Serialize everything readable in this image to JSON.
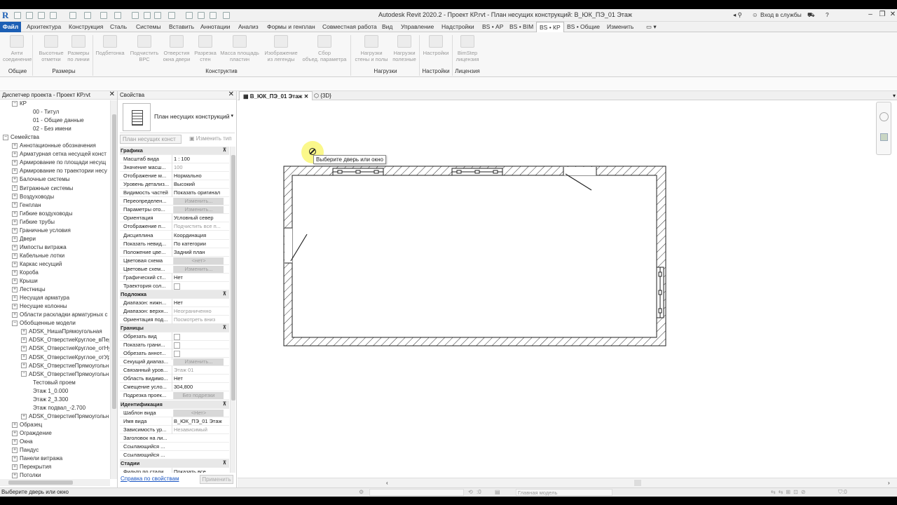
{
  "window": {
    "title": "Autodesk Revit 2020.2 - Проект КР.rvt - План несущих конструкций: В_ЮК_ПЭ_01 Этаж",
    "login": "Вход в службы",
    "help": "?"
  },
  "menu": {
    "file": "Файл",
    "tabs": [
      "Архитектура",
      "Конструкция",
      "Сталь",
      "Системы",
      "Вставить",
      "Аннотации",
      "Анализ",
      "Формы и генплан",
      "Совместная работа",
      "Вид",
      "Управление",
      "Надстройки",
      "BS • АР",
      "BS • BIM",
      "BS • КР",
      "BS • Общие",
      "Изменить"
    ],
    "active": "BS • КР"
  },
  "ribbon": {
    "buttons": [
      {
        "label": "Анти\nсоединение"
      },
      {
        "label": "Высотные\nотметки"
      },
      {
        "label": "Размеры\nпо линии"
      },
      {
        "label": "Подбетонка"
      },
      {
        "label": "Подчистить\nВРС"
      },
      {
        "label": "Отверстия\nокна двери"
      },
      {
        "label": "Разрезка\nстен"
      },
      {
        "label": "Масса площадь\nпластин"
      },
      {
        "label": "Изображение\nиз легенды"
      },
      {
        "label": "Сбор\nобъед. параметра"
      },
      {
        "label": "Нагрузки\nстены и полы"
      },
      {
        "label": "Нагрузки\nполезные"
      },
      {
        "label": "Настройки"
      },
      {
        "label": "BimStep\nлицензия"
      }
    ],
    "groups": [
      "Общие",
      "Размеры",
      "Конструктив",
      "Нагрузки",
      "Настройки",
      "Лицензия"
    ]
  },
  "browser": {
    "title": "Диспетчер проекта - Проект КР.rvt",
    "items": [
      {
        "label": "КР",
        "level": 1,
        "toggle": "−"
      },
      {
        "label": "00 - Титул",
        "level": 3,
        "toggle": ""
      },
      {
        "label": "01 - Общие данные",
        "level": 3,
        "toggle": ""
      },
      {
        "label": "02 - Без имени",
        "level": 3,
        "toggle": ""
      },
      {
        "label": "Семейства",
        "level": 0,
        "toggle": "−"
      },
      {
        "label": "Аннотационные обозначения",
        "level": 1,
        "toggle": "+"
      },
      {
        "label": "Арматурная сетка несущей конст",
        "level": 1,
        "toggle": "+"
      },
      {
        "label": "Армирование по площади несущ",
        "level": 1,
        "toggle": "+"
      },
      {
        "label": "Армирование по траектории несу",
        "level": 1,
        "toggle": "+"
      },
      {
        "label": "Балочные системы",
        "level": 1,
        "toggle": "+"
      },
      {
        "label": "Витражные системы",
        "level": 1,
        "toggle": "+"
      },
      {
        "label": "Воздуховоды",
        "level": 1,
        "toggle": "+"
      },
      {
        "label": "Генплан",
        "level": 1,
        "toggle": "+"
      },
      {
        "label": "Гибкие воздуховоды",
        "level": 1,
        "toggle": "+"
      },
      {
        "label": "Гибкие трубы",
        "level": 1,
        "toggle": "+"
      },
      {
        "label": "Граничные условия",
        "level": 1,
        "toggle": "+"
      },
      {
        "label": "Двери",
        "level": 1,
        "toggle": "+"
      },
      {
        "label": "Импосты витража",
        "level": 1,
        "toggle": "+"
      },
      {
        "label": "Кабельные лотки",
        "level": 1,
        "toggle": "+"
      },
      {
        "label": "Каркас несущий",
        "level": 1,
        "toggle": "+"
      },
      {
        "label": "Короба",
        "level": 1,
        "toggle": "+"
      },
      {
        "label": "Крыши",
        "level": 1,
        "toggle": "+"
      },
      {
        "label": "Лестницы",
        "level": 1,
        "toggle": "+"
      },
      {
        "label": "Несущая арматура",
        "level": 1,
        "toggle": "+"
      },
      {
        "label": "Несущие колонны",
        "level": 1,
        "toggle": "+"
      },
      {
        "label": "Области раскладки арматурных с",
        "level": 1,
        "toggle": "+"
      },
      {
        "label": "Обобщенные модели",
        "level": 1,
        "toggle": "−"
      },
      {
        "label": "ADSK_НишаПрямоугольная",
        "level": 2,
        "toggle": "+"
      },
      {
        "label": "ADSK_ОтверстиеКруглое_вПер",
        "level": 2,
        "toggle": "+"
      },
      {
        "label": "ADSK_ОтверстиеКруглое_отНу",
        "level": 2,
        "toggle": "+"
      },
      {
        "label": "ADSK_ОтверстиеКруглое_отУр",
        "level": 2,
        "toggle": "+"
      },
      {
        "label": "ADSK_ОтверстиеПрямоугольн",
        "level": 2,
        "toggle": "+"
      },
      {
        "label": "ADSK_ОтверстиеПрямоугольн",
        "level": 2,
        "toggle": "−"
      },
      {
        "label": "Тестовый проем",
        "level": 3,
        "toggle": ""
      },
      {
        "label": "Этаж 1_0.000",
        "level": 3,
        "toggle": ""
      },
      {
        "label": "Этаж 2_3.300",
        "level": 3,
        "toggle": ""
      },
      {
        "label": "Этаж подвал_-2.700",
        "level": 3,
        "toggle": ""
      },
      {
        "label": "ADSK_ОтверстиеПрямоугольн",
        "level": 2,
        "toggle": "+"
      },
      {
        "label": "Образец",
        "level": 1,
        "toggle": "+"
      },
      {
        "label": "Ограждение",
        "level": 1,
        "toggle": "+"
      },
      {
        "label": "Окна",
        "level": 1,
        "toggle": "+"
      },
      {
        "label": "Пандус",
        "level": 1,
        "toggle": "+"
      },
      {
        "label": "Панели витража",
        "level": 1,
        "toggle": "+"
      },
      {
        "label": "Перекрытия",
        "level": 1,
        "toggle": "+"
      },
      {
        "label": "Потолки",
        "level": 1,
        "toggle": "+"
      }
    ]
  },
  "properties": {
    "title": "Свойства",
    "type_name": "План несущих конструкций",
    "filter": "План несущих конст",
    "edit_type": "Изменить тип",
    "rows": [
      {
        "kind": "sec",
        "k": "Графика"
      },
      {
        "k": "Масштаб вида",
        "v": "1 : 100"
      },
      {
        "k": "Значение масш...",
        "v": "100",
        "dis": true
      },
      {
        "k": "Отображение м...",
        "v": "Нормально"
      },
      {
        "k": "Уровень детализ...",
        "v": "Высокий"
      },
      {
        "k": "Видимость частей",
        "v": "Показать оригинал"
      },
      {
        "k": "Переопределен...",
        "v": "Изменить...",
        "btn": true
      },
      {
        "k": "Параметры ото...",
        "v": "Изменить...",
        "btn": true
      },
      {
        "k": "Ориентация",
        "v": "Условный север"
      },
      {
        "k": "Отображение п...",
        "v": "Подчистить все п...",
        "dis": true
      },
      {
        "k": "Дисциплина",
        "v": "Координация"
      },
      {
        "k": "Показать невид...",
        "v": "По категории"
      },
      {
        "k": "Положение цве...",
        "v": "Задний план"
      },
      {
        "k": "Цветовая схема",
        "v": "<нет>",
        "btn": true
      },
      {
        "k": "Цветовые схем...",
        "v": "Изменить...",
        "btn": true
      },
      {
        "k": "Графический ст...",
        "v": "Нет"
      },
      {
        "k": "Траектория сол...",
        "v": "",
        "chk": true
      },
      {
        "kind": "sec",
        "k": "Подложка"
      },
      {
        "k": "Диапазон: нижн...",
        "v": "Нет"
      },
      {
        "k": "Диапазон: верхн...",
        "v": "Неограниченно",
        "dis": true
      },
      {
        "k": "Ориентация под...",
        "v": "Посмотреть вниз",
        "dis": true
      },
      {
        "kind": "sec",
        "k": "Границы"
      },
      {
        "k": "Обрезать вид",
        "v": "",
        "chk": true
      },
      {
        "k": "Показать грани...",
        "v": "",
        "chk": true
      },
      {
        "k": "Обрезать аннот...",
        "v": "",
        "chk": true
      },
      {
        "k": "Секущий диапаз...",
        "v": "Изменить...",
        "btn": true
      },
      {
        "k": "Связанный уров...",
        "v": "Этаж 01",
        "dis": true
      },
      {
        "k": "Область видимо...",
        "v": "Нет"
      },
      {
        "k": "Смещение усло...",
        "v": "304,800"
      },
      {
        "k": "Подрезка проек...",
        "v": "Без подрезки",
        "btn": true
      },
      {
        "kind": "sec",
        "k": "Идентификация"
      },
      {
        "k": "Шаблон вида",
        "v": "<Нет>",
        "btn": true
      },
      {
        "k": "Имя вида",
        "v": "В_ЮК_ПЭ_01 Этаж"
      },
      {
        "k": "Зависимость ур...",
        "v": "Независимый",
        "dis": true
      },
      {
        "k": "Заголовок на ли...",
        "v": ""
      },
      {
        "k": "Ссылающийся ...",
        "v": "",
        "dis": true
      },
      {
        "k": "Ссылающийся ...",
        "v": "",
        "dis": true
      },
      {
        "kind": "sec",
        "k": "Стадии"
      },
      {
        "k": "Фильтр по стади...",
        "v": "Показать все"
      }
    ],
    "help_link": "Справка по свойствам",
    "apply": "Применить"
  },
  "view": {
    "tabs": [
      "В_ЮК_ПЭ_01 Этаж",
      "{3D}"
    ],
    "tooltip": "Выберите дверь или окно"
  },
  "viewbar": {
    "model": "Главная модель",
    "filter_count": ":0"
  },
  "status": {
    "text": "Выберите дверь или окно"
  }
}
